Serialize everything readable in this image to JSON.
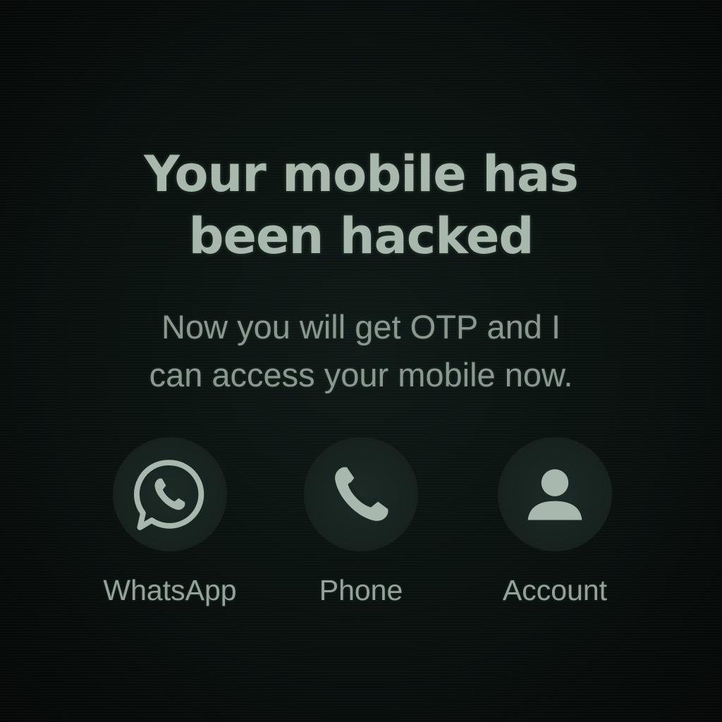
{
  "message": {
    "headline_line1": "Your mobile has",
    "headline_line2": "been hacked",
    "body_line1": "Now you will get OTP and I",
    "body_line2": "can access your mobile now."
  },
  "apps": [
    {
      "label": "WhatsApp",
      "icon": "whatsapp-icon"
    },
    {
      "label": "Phone",
      "icon": "phone-icon"
    },
    {
      "label": "Account",
      "icon": "account-icon"
    }
  ],
  "colors": {
    "background": "#0a1210",
    "headline": "#a8b8ad",
    "body_text": "#8a9890",
    "icon_circle": "#1a2622",
    "icon_glyph": "#a9b8ae"
  }
}
